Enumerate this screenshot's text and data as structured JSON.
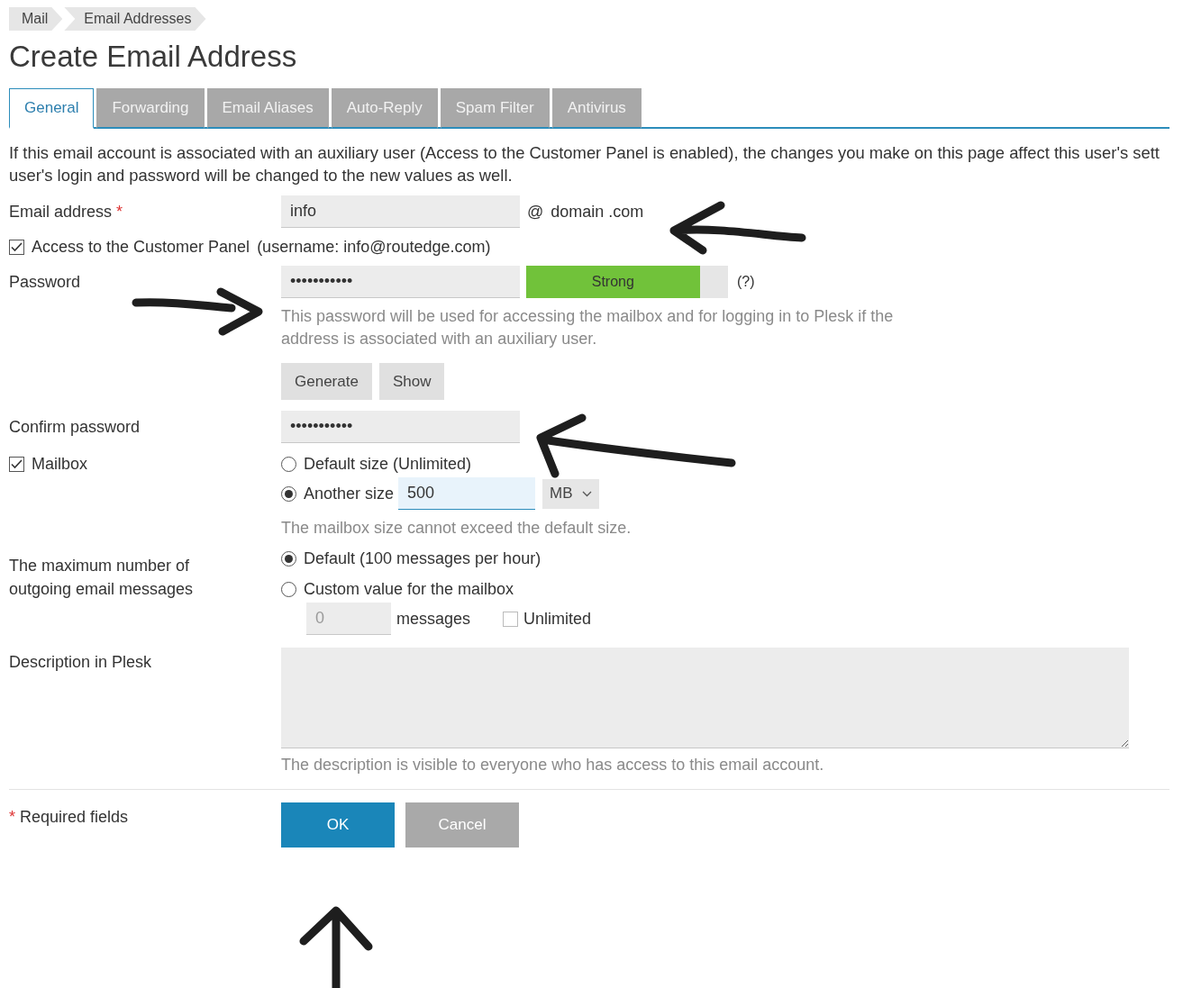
{
  "breadcrumb": [
    {
      "label": "Mail"
    },
    {
      "label": "Email Addresses"
    }
  ],
  "title": "Create Email Address",
  "tabs": [
    {
      "label": "General",
      "selected": true
    },
    {
      "label": "Forwarding",
      "selected": false
    },
    {
      "label": "Email Aliases",
      "selected": false
    },
    {
      "label": "Auto-Reply",
      "selected": false
    },
    {
      "label": "Spam Filter",
      "selected": false
    },
    {
      "label": "Antivirus",
      "selected": false
    }
  ],
  "intro": [
    "If this email account is associated with an auxiliary user (Access to the Customer Panel is enabled), the changes you make on this page affect this user's sett",
    "user's login and password will be changed to the new values as well."
  ],
  "email": {
    "label": "Email address",
    "required": true,
    "value": "info",
    "at": "@",
    "domain": "domain .com"
  },
  "customer_panel": {
    "checked": true,
    "label": "Access to the Customer Panel",
    "username": "(username: info@routedge.com)"
  },
  "password": {
    "label": "Password",
    "value": "•••••••••••",
    "strength": {
      "label": "Strong",
      "level": 0.86
    },
    "help": "(?)",
    "hint": [
      "This password will be used for accessing the mailbox and for logging in to Plesk if the",
      "address is associated with an auxiliary user."
    ],
    "buttons": [
      "Generate",
      "Show"
    ]
  },
  "confirm": {
    "label": "Confirm password",
    "value": "•••••••••••"
  },
  "mailbox": {
    "checked": true,
    "label": "Mailbox",
    "options": [
      {
        "label": "Default size (Unlimited)",
        "selected": false
      },
      {
        "label": "Another size",
        "selected": true,
        "value": "500",
        "unit": "MB"
      }
    ],
    "hint": "The mailbox size cannot exceed the default size."
  },
  "outgoing": {
    "label": [
      "The maximum number of",
      "outgoing email messages"
    ],
    "options": [
      {
        "label": "Default (100 messages per hour)",
        "selected": true
      },
      {
        "label": "Custom value for the mailbox",
        "selected": false
      }
    ],
    "custom": {
      "value": "0",
      "disabled": true,
      "unit": "messages",
      "unlimited": {
        "label": "Unlimited",
        "checked": false
      }
    }
  },
  "description": {
    "label": "Description in Plesk",
    "hint": "The description is visible to everyone who has access to this email account."
  },
  "required_note": {
    "mark": "*",
    "label": "Required fields"
  },
  "actions": [
    {
      "label": "OK",
      "kind": "primary"
    },
    {
      "label": "Cancel",
      "kind": "secondary"
    }
  ]
}
